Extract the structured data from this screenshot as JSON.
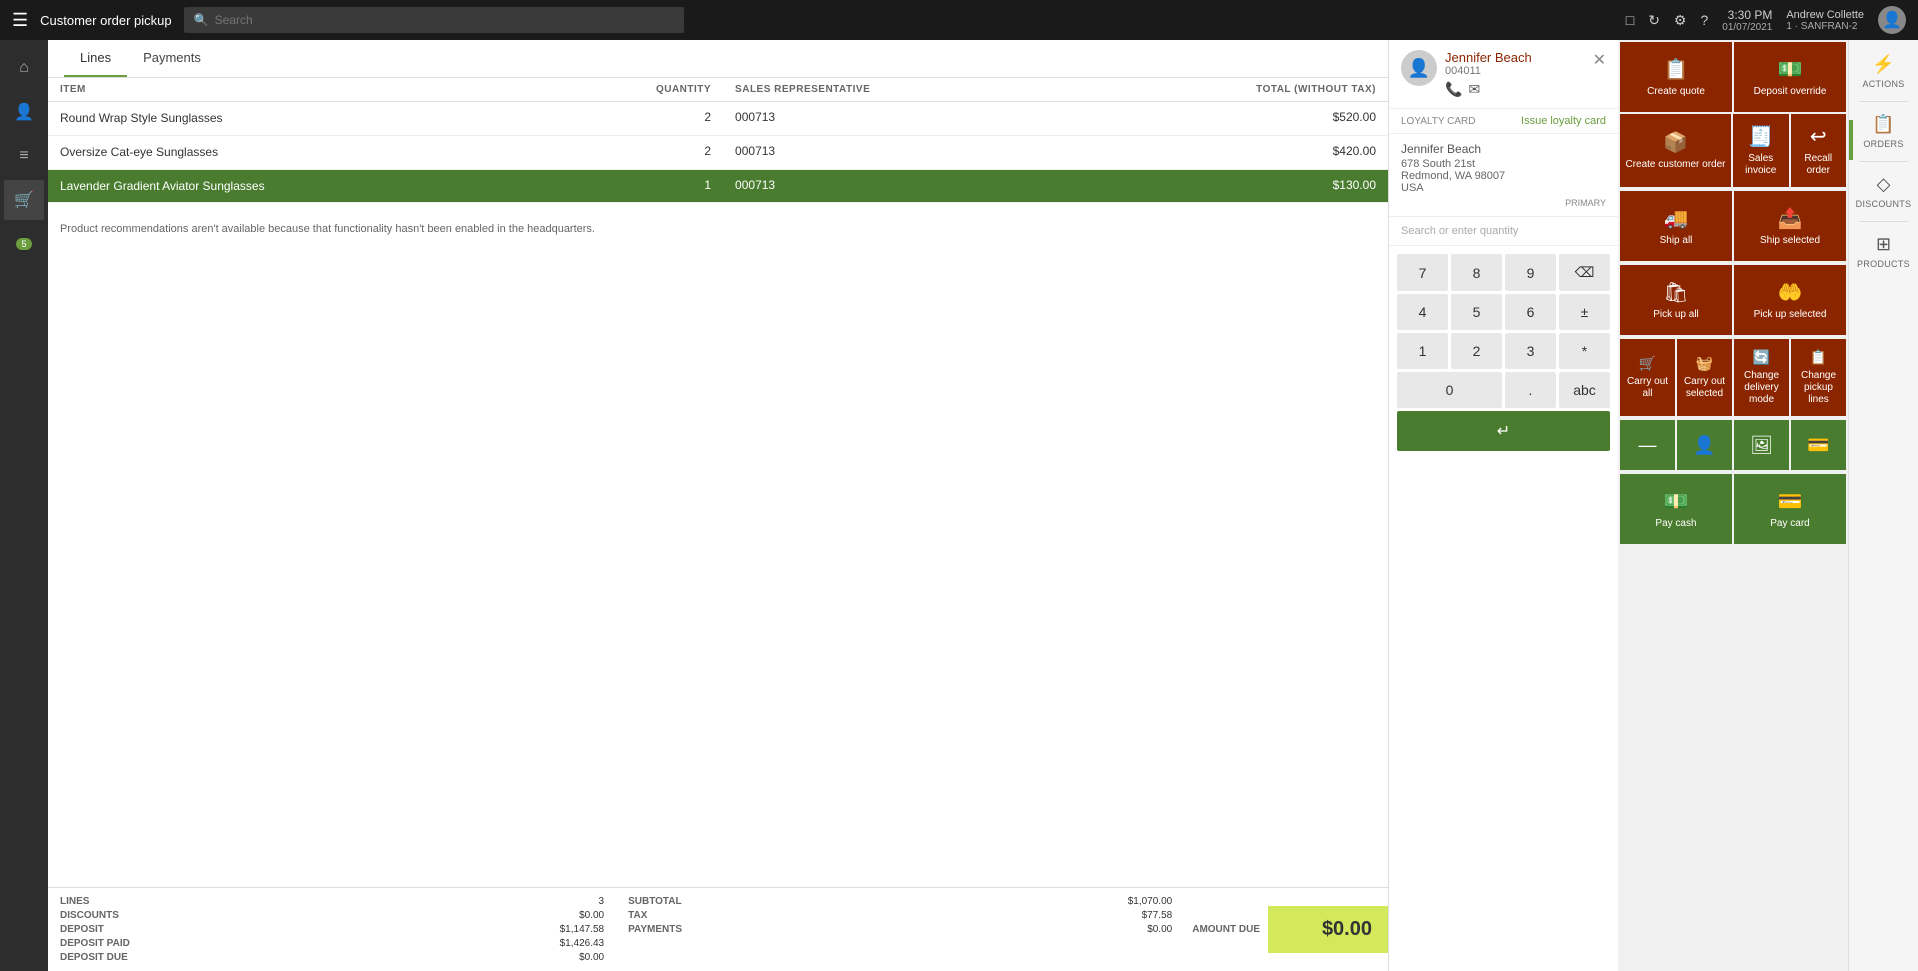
{
  "topbar": {
    "menu_icon": "☰",
    "title": "Customer order pickup",
    "search_placeholder": "Search",
    "time": "3:30 PM",
    "date": "01/07/2021",
    "store": "1 · SANFRAN-2",
    "user": "Andrew Collette",
    "icons": {
      "chat": "💬",
      "refresh": "↻",
      "settings": "⚙",
      "help": "?"
    }
  },
  "sidebar": {
    "items": [
      {
        "icon": "⌂",
        "label": "home",
        "active": false
      },
      {
        "icon": "👤",
        "label": "customers",
        "active": false
      },
      {
        "icon": "≡",
        "label": "menu",
        "active": false
      },
      {
        "icon": "🛒",
        "label": "cart",
        "active": true
      },
      {
        "icon": "5",
        "label": "badge",
        "active": false
      }
    ]
  },
  "tabs": [
    {
      "label": "Lines",
      "active": true
    },
    {
      "label": "Payments",
      "active": false
    }
  ],
  "table": {
    "columns": [
      "ITEM",
      "QUANTITY",
      "SALES REPRESENTATIVE",
      "TOTAL (WITHOUT TAX)"
    ],
    "rows": [
      {
        "item": "Round Wrap Style Sunglasses",
        "quantity": "2",
        "rep": "000713",
        "total": "$520.00",
        "selected": false
      },
      {
        "item": "Oversize Cat-eye Sunglasses",
        "quantity": "2",
        "rep": "000713",
        "total": "$420.00",
        "selected": false
      },
      {
        "item": "Lavender Gradient Aviator Sunglasses",
        "quantity": "1",
        "rep": "000713",
        "total": "$130.00",
        "selected": true
      }
    ]
  },
  "recommendation_msg": "Product recommendations aren't available because that functionality hasn't been enabled in the headquarters.",
  "footer": {
    "lines_label": "LINES",
    "lines_value": "3",
    "discounts_label": "DISCOUNTS",
    "discounts_value": "$0.00",
    "deposit_label": "DEPOSIT",
    "deposit_value": "$1,147.58",
    "deposit_paid_label": "DEPOSIT PAID",
    "deposit_paid_value": "$1,426.43",
    "deposit_due_label": "DEPOSIT DUE",
    "deposit_due_value": "$0.00",
    "subtotal_label": "SUBTOTAL",
    "subtotal_value": "$1,070.00",
    "tax_label": "TAX",
    "tax_value": "$77.58",
    "payments_label": "PAYMENTS",
    "payments_value": "$0.00",
    "amount_due_label": "AMOUNT DUE",
    "amount_due_value": "$0.00"
  },
  "customer": {
    "name": "Jennifer Beach",
    "id": "004011",
    "address1": "Jennifer Beach",
    "address2": "678 South 21st",
    "address3": "Redmond, WA 98007",
    "address4": "USA",
    "primary": "PRIMARY",
    "loyalty_label": "LOYALTY CARD",
    "loyalty_action": "Issue loyalty card"
  },
  "numpad": {
    "search_qty": "Search or enter quantity",
    "keys": [
      "7",
      "8",
      "9",
      "⌫",
      "4",
      "5",
      "6",
      "±",
      "1",
      "2",
      "3",
      "*",
      "0",
      ".",
      "abc"
    ],
    "enter_icon": "↵"
  },
  "action_buttons": {
    "row1": [
      {
        "label": "Create quote",
        "icon": "📋",
        "color": "brown"
      },
      {
        "label": "Deposit override",
        "icon": "💵",
        "color": "brown"
      }
    ],
    "row2": [
      {
        "label": "Create customer order",
        "icon": "📦",
        "color": "brown"
      },
      {
        "label": "Sales invoice",
        "icon": "🧾",
        "color": "brown"
      },
      {
        "label": "Recall order",
        "icon": "↩",
        "color": "brown"
      }
    ],
    "row3": [
      {
        "label": "Ship all",
        "icon": "🚚",
        "color": "brown"
      },
      {
        "label": "Ship selected",
        "icon": "📤",
        "color": "brown"
      }
    ],
    "row4": [
      {
        "label": "Pick up all",
        "icon": "🛍",
        "color": "brown"
      },
      {
        "label": "Pick up selected",
        "icon": "🤲",
        "color": "brown"
      }
    ],
    "row5": [
      {
        "label": "Carry out all",
        "icon": "🛒",
        "color": "brown"
      },
      {
        "label": "Carry out selected",
        "icon": "🧺",
        "color": "brown"
      },
      {
        "label": "Change delivery mode",
        "icon": "🔄",
        "color": "brown"
      },
      {
        "label": "Change pickup lines",
        "icon": "📋",
        "color": "brown"
      }
    ],
    "row6_icons": [
      {
        "label": "",
        "icon": "—",
        "color": "green"
      },
      {
        "label": "",
        "icon": "👤",
        "color": "green"
      },
      {
        "label": "",
        "icon": "🖼",
        "color": "green"
      },
      {
        "label": "",
        "icon": "💳",
        "color": "green"
      }
    ],
    "row7": [
      {
        "label": "Pay cash",
        "icon": "💵",
        "color": "green"
      },
      {
        "label": "Pay card",
        "icon": "💳",
        "color": "green"
      }
    ]
  },
  "right_sidebar": {
    "items": [
      {
        "icon": "⚡",
        "label": "ACTIONS"
      },
      {
        "icon": "📋",
        "label": "ORDERS"
      },
      {
        "icon": "◇",
        "label": "DISCOUNTS"
      },
      {
        "icon": "⊞",
        "label": "PRODUCTS"
      }
    ]
  }
}
